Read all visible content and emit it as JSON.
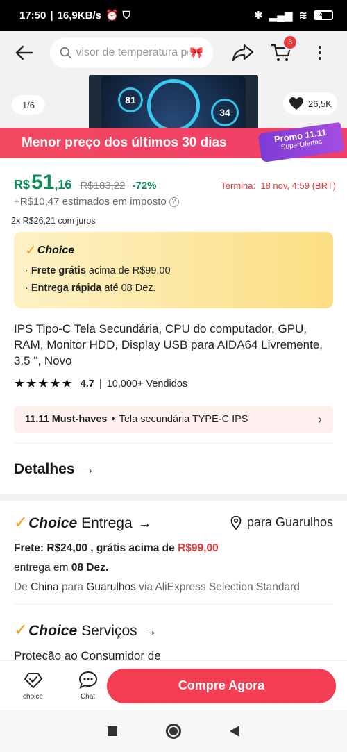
{
  "status_bar": {
    "time": "17:50",
    "speed": "16,9KB/s",
    "battery": "42"
  },
  "header": {
    "search_placeholder": "visor de temperatura pc",
    "cart_count": "3"
  },
  "gallery": {
    "counter": "1/6",
    "likes": "26,5K",
    "gauge_left": "81",
    "gauge_right": "34"
  },
  "promo": {
    "banner_text": "Menor preço dos últimos 30 dias",
    "tag_line1": "Promo 11.11",
    "tag_line2": "SuperOfertas"
  },
  "price": {
    "currency": "R$",
    "integer": "51",
    "cents": ",16",
    "original": "R$183,22",
    "discount": "-72%",
    "ends_label": "Termina:",
    "ends_date": "18 nov, 4:59 (BRT)",
    "tax_text": "+R$10,47 estimados em imposto",
    "installments": "2x R$26,21 com juros"
  },
  "choice_box": {
    "logo": "Choice",
    "line1_bold": "Frete grátis",
    "line1_rest": "acima de R$99,00",
    "line2_bold": "Entrega rápida",
    "line2_rest": "até 08 Dez."
  },
  "product": {
    "title": "IPS Tipo-C Tela Secundária, CPU do computador, GPU, RAM, Monitor HDD, Display USB para AIDA64 Livremente, 3.5 \", Novo",
    "rating": "4.7",
    "sold": "10,000+ Vendidos"
  },
  "must_haves": {
    "title": "11.11 Must-haves",
    "text": "Tela secundária TYPE-C IPS"
  },
  "details_label": "Detalhes",
  "delivery": {
    "choice_word": "Choice",
    "title": "Entrega",
    "location": "para Guarulhos",
    "frete_text": "Frete: R$24,00 , grátis acima de",
    "frete_threshold": "R$99,00",
    "entrega_prefix": "entrega em",
    "entrega_date": "08 Dez.",
    "origin_de": "De",
    "origin_country": "China",
    "origin_para": "para",
    "origin_city": "Guarulhos",
    "origin_via": "via AliExpress Selection Standard"
  },
  "services": {
    "choice_word": "Choice",
    "title": "Serviços",
    "protection": "Proteção ao Consumidor de"
  },
  "bottom": {
    "choice_tab": "choice",
    "chat_tab": "Chat",
    "buy_label": "Compre Agora"
  }
}
